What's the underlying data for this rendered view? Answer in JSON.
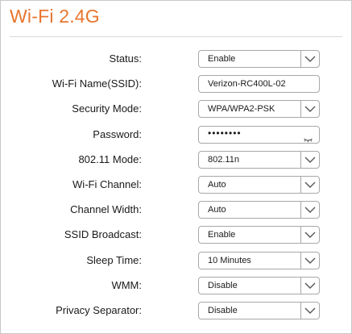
{
  "title": "Wi-Fi 2.4G",
  "fields": [
    {
      "label": "Status:",
      "value": "Enable",
      "type": "select"
    },
    {
      "label": "Wi-Fi Name(SSID):",
      "value": "Verizon-RC400L-02",
      "type": "text"
    },
    {
      "label": "Security Mode:",
      "value": "WPA/WPA2-PSK",
      "type": "select"
    },
    {
      "label": "Password:",
      "value": "••••••••",
      "type": "password"
    },
    {
      "label": "802.11 Mode:",
      "value": "802.11n",
      "type": "select"
    },
    {
      "label": "Wi-Fi Channel:",
      "value": "Auto",
      "type": "select"
    },
    {
      "label": "Channel Width:",
      "value": "Auto",
      "type": "select"
    },
    {
      "label": "SSID Broadcast:",
      "value": "Enable",
      "type": "select"
    },
    {
      "label": "Sleep Time:",
      "value": "10 Minutes",
      "type": "select"
    },
    {
      "label": "WMM:",
      "value": "Disable",
      "type": "select"
    },
    {
      "label": "Privacy Separator:",
      "value": "Disable",
      "type": "select"
    }
  ],
  "icons": {
    "dropdown": "chevron-down-icon",
    "password_toggle": "eye-closed-icon"
  },
  "colors": {
    "title": "#e8752e",
    "border": "#a8a8a8"
  }
}
